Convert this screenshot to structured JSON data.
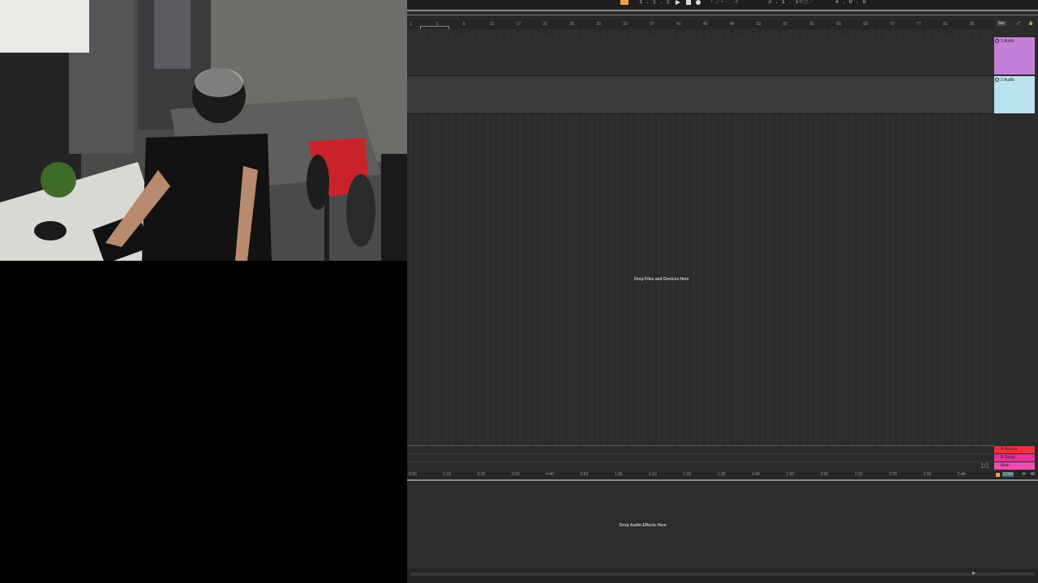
{
  "transport": {
    "position": "1 . 1 . 1",
    "loop_start": "3 . 1 . 1",
    "loop_length": "4 . 0 . 0"
  },
  "ruler": {
    "bars": [
      "1",
      "5",
      "9",
      "13",
      "17",
      "21",
      "25",
      "29",
      "33",
      "37",
      "41",
      "45",
      "49",
      "53",
      "57",
      "61",
      "65",
      "69",
      "73",
      "77",
      "81",
      "85"
    ],
    "set_label": "Set"
  },
  "tracks": [
    {
      "name": "1 Audio",
      "color": "#c47fd8"
    },
    {
      "name": "2 Audio",
      "color": "#b9e2ee"
    }
  ],
  "arrangement": {
    "drop_label": "Drop Files and Devices Here"
  },
  "returns": [
    {
      "name": "A Reverb",
      "color": "#f0313c"
    },
    {
      "name": "B Delay",
      "color": "#e82f9c"
    },
    {
      "name": "Main",
      "color": "#f04cb0"
    }
  ],
  "page_indicator": "1/1",
  "timeline": {
    "times": [
      "0:00",
      "0:10",
      "0:20",
      "0:30",
      "0:40",
      "0:50",
      "1:00",
      "1:10",
      "1:20",
      "1:30",
      "1:40",
      "1:50",
      "2:00",
      "2:10",
      "2:20",
      "2:30",
      "2:40"
    ]
  },
  "devices": {
    "drop_label": "Drop Audio Effects Here"
  },
  "footer": {
    "zoom": "0.00s",
    "h_label": "H",
    "w_label": "W"
  }
}
